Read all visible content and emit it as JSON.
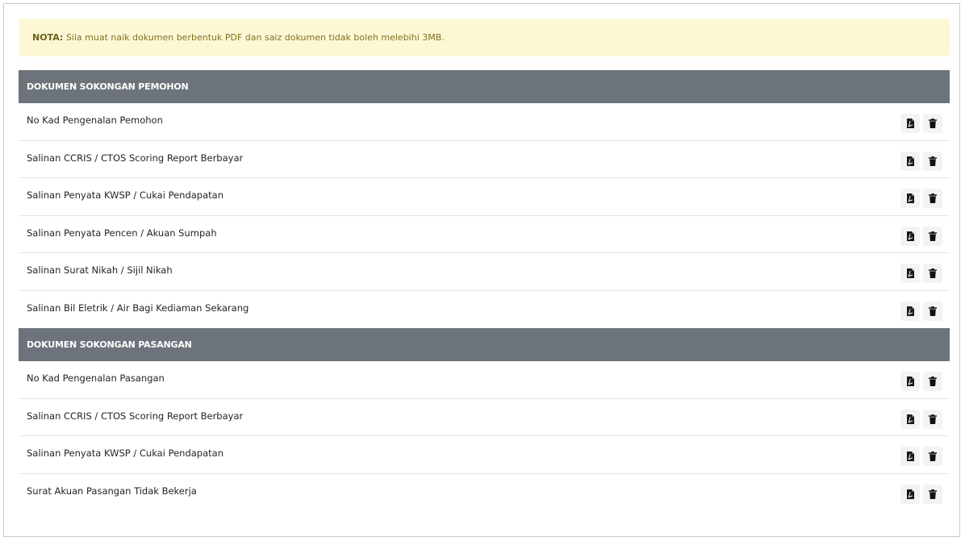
{
  "note": {
    "label": "NOTA:",
    "text": " Sila muat naik dokumen berbentuk PDF dan saiz dokumen tidak boleh melebihi 3MB."
  },
  "sections": [
    {
      "title": "DOKUMEN SOKONGAN PEMOHON",
      "items": [
        {
          "label": "No Kad Pengenalan Pemohon"
        },
        {
          "label": "Salinan CCRIS / CTOS Scoring Report Berbayar"
        },
        {
          "label": "Salinan Penyata KWSP / Cukai Pendapatan"
        },
        {
          "label": "Salinan Penyata Pencen / Akuan Sumpah"
        },
        {
          "label": "Salinan Surat Nikah / Sijil Nikah"
        },
        {
          "label": "Salinan Bil Eletrik / Air Bagi Kediaman Sekarang"
        }
      ]
    },
    {
      "title": "DOKUMEN SOKONGAN PASANGAN",
      "items": [
        {
          "label": "No Kad Pengenalan Pasangan"
        },
        {
          "label": "Salinan CCRIS / CTOS Scoring Report Berbayar"
        },
        {
          "label": "Salinan Penyata KWSP / Cukai Pendapatan"
        },
        {
          "label": "Surat Akuan Pasangan Tidak Bekerja"
        }
      ]
    }
  ],
  "icons": {
    "view": "file-pdf-icon",
    "delete": "trash-icon"
  },
  "colors": {
    "header_bg": "#6c737a",
    "alert_bg": "#fcf8d6",
    "alert_text": "#81711f"
  }
}
